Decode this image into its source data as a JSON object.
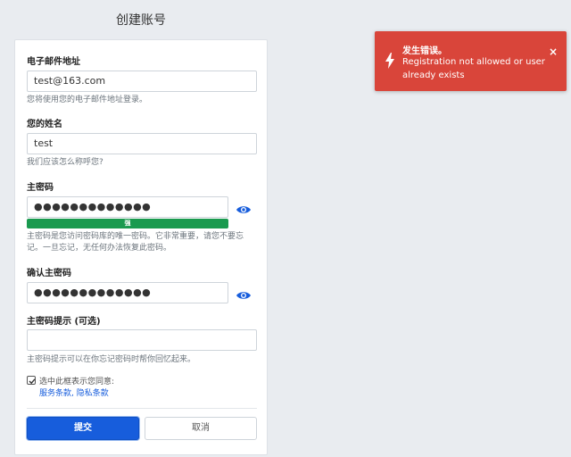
{
  "page": {
    "title": "创建账号"
  },
  "form": {
    "email": {
      "label": "电子邮件地址",
      "value": "test@163.com",
      "help": "您将使用您的电子邮件地址登录。"
    },
    "name": {
      "label": "您的姓名",
      "value": "test",
      "help": "我们应该怎么称呼您?"
    },
    "master_password": {
      "label": "主密码",
      "value": "●●●●●●●●●●●●●",
      "strength_label": "强",
      "strength_level": 1.0,
      "help": "主密码是您访问密码库的唯一密码。它非常重要，请您不要忘记。一旦忘记，无任何办法恢复此密码。"
    },
    "confirm_password": {
      "label": "确认主密码",
      "value": "●●●●●●●●●●●●●"
    },
    "hint": {
      "label": "主密码提示 (可选)",
      "value": "",
      "help": "主密码提示可以在你忘记密码时帮你回忆起来。"
    },
    "agree": {
      "checked": true,
      "text": "选中此框表示您同意:",
      "terms_label": "服务条款",
      "separator": ",",
      "privacy_label": "隐私条款"
    },
    "submit_label": "提交",
    "cancel_label": "取消"
  },
  "toast": {
    "title": "发生错误。",
    "message": "Registration not allowed or user already exists",
    "close_label": "×",
    "color": "#d9453a"
  },
  "colors": {
    "primary": "#175ddc",
    "strength_strong": "#1a9a4f",
    "background": "#e9ecf0"
  },
  "icons": {
    "reveal": "eye-icon",
    "toast": "bolt-icon",
    "check": "check-icon"
  }
}
